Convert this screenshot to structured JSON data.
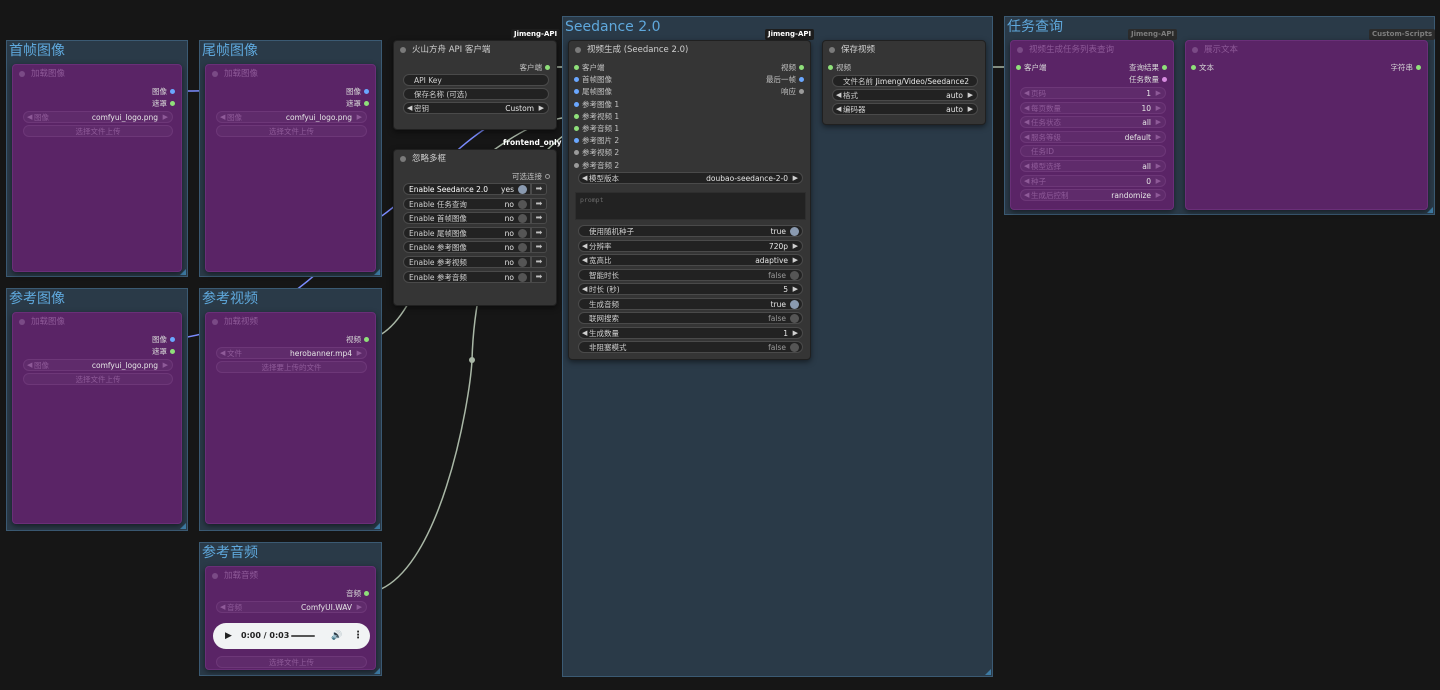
{
  "colors": {
    "background": "#161616",
    "group": "#2a3a48",
    "group_title": "#5fa8dc",
    "muted_node": "#5a2466",
    "link_blue": "#7b8cff",
    "link_gray": "#a9b7a6"
  },
  "groups": {
    "first_frame": "首帧图像",
    "last_frame": "尾帧图像",
    "ref_image": "参考图像",
    "ref_video": "参考视频",
    "ref_audio": "参考音频",
    "seedance": "Seedance 2.0",
    "task_query": "任务查询"
  },
  "load_image_first": {
    "title": "加载图像",
    "out_image": "图像",
    "out_mask": "遮罩",
    "w_image_label": "图像",
    "w_image_value": "comfyui_logo.png",
    "upload": "选择文件上传"
  },
  "load_image_last": {
    "title": "加载图像",
    "out_image": "图像",
    "out_mask": "遮罩",
    "w_image_label": "图像",
    "w_image_value": "comfyui_logo.png",
    "upload": "选择文件上传"
  },
  "load_image_ref": {
    "title": "加载图像",
    "out_image": "图像",
    "out_mask": "遮罩",
    "w_image_label": "图像",
    "w_image_value": "comfyui_logo.png",
    "upload": "选择文件上传"
  },
  "load_video": {
    "title": "加载视频",
    "out_video": "视频",
    "w_file_label": "文件",
    "w_file_value": "herobanner.mp4",
    "upload": "选择要上传的文件"
  },
  "load_audio": {
    "title": "加载音频",
    "out_audio": "音频",
    "w_audio_label": "音频",
    "w_audio_value": "ComfyUI.WAV",
    "player_time": "0:00 / 0:03",
    "upload": "选择文件上传"
  },
  "api_client": {
    "badge": "Jimeng-API",
    "title": "火山方舟 API 客户端",
    "out_client": "客户端",
    "w_api_key": "API Key",
    "w_save_name": "保存名称 (可选)",
    "w_key_label": "密钥",
    "w_key_value": "Custom",
    "float_label": "frontend_only"
  },
  "bypasser": {
    "title": "忽略多框",
    "out_optional": "可选连接",
    "rows": [
      {
        "label": "Enable Seedance 2.0",
        "value": "yes",
        "on": true
      },
      {
        "label": "Enable 任务查询",
        "value": "no",
        "on": false
      },
      {
        "label": "Enable 首帧图像",
        "value": "no",
        "on": false
      },
      {
        "label": "Enable 尾帧图像",
        "value": "no",
        "on": false
      },
      {
        "label": "Enable 参考图像",
        "value": "no",
        "on": false
      },
      {
        "label": "Enable 参考视频",
        "value": "no",
        "on": false
      },
      {
        "label": "Enable 参考音频",
        "value": "no",
        "on": false
      }
    ]
  },
  "video_gen": {
    "badge": "Jimeng-API",
    "title": "视频生成 (Seedance 2.0)",
    "inputs": [
      "客户端",
      "首帧图像",
      "尾帧图像",
      "参考图像 1",
      "参考视频 1",
      "参考音频 1",
      "参考图片 2",
      "参考视频 2",
      "参考音频 2"
    ],
    "outputs": [
      "视频",
      "最后一帧",
      "响应"
    ],
    "w_model_label": "模型版本",
    "w_model_value": "doubao-seedance-2-0",
    "prompt_placeholder": "prompt",
    "widgets": [
      {
        "label": "使用随机种子",
        "value": "true",
        "kind": "toggle",
        "on": true
      },
      {
        "label": "分辨率",
        "value": "720p",
        "kind": "combo"
      },
      {
        "label": "宽高比",
        "value": "adaptive",
        "kind": "combo"
      },
      {
        "label": "智能时长",
        "value": "false",
        "kind": "toggle",
        "on": false
      },
      {
        "label": "时长 (秒)",
        "value": "5",
        "kind": "combo"
      },
      {
        "label": "生成音频",
        "value": "true",
        "kind": "toggle",
        "on": true
      },
      {
        "label": "联网搜索",
        "value": "false",
        "kind": "toggle",
        "on": false
      },
      {
        "label": "生成数量",
        "value": "1",
        "kind": "combo"
      },
      {
        "label": "非阻塞模式",
        "value": "false",
        "kind": "toggle",
        "on": false
      }
    ]
  },
  "save_video": {
    "title": "保存视频",
    "in_video": "视频",
    "w_prefix_label": "文件名前 ...",
    "w_prefix_value": "Jimeng/Video/Seedance2",
    "w_format_label": "格式",
    "w_format_value": "auto",
    "w_codec_label": "编码器",
    "w_codec_value": "auto"
  },
  "task_query_node": {
    "badge": "Jimeng-API",
    "title": "视频生成任务列表查询",
    "in_client": "客户端",
    "out_result": "查询结果",
    "out_count": "任务数量",
    "widgets": [
      {
        "label": "页码",
        "value": "1"
      },
      {
        "label": "每页数量",
        "value": "10"
      },
      {
        "label": "任务状态",
        "value": "all"
      },
      {
        "label": "服务等级",
        "value": "default"
      },
      {
        "label": "任务ID",
        "value": ""
      },
      {
        "label": "模型选择",
        "value": "all"
      },
      {
        "label": "种子",
        "value": "0"
      },
      {
        "label": "生成后控制",
        "value": "randomize"
      }
    ]
  },
  "show_text": {
    "badge": "Custom-Scripts",
    "title": "展示文本",
    "in_text": "文本",
    "out_string": "字符串"
  }
}
